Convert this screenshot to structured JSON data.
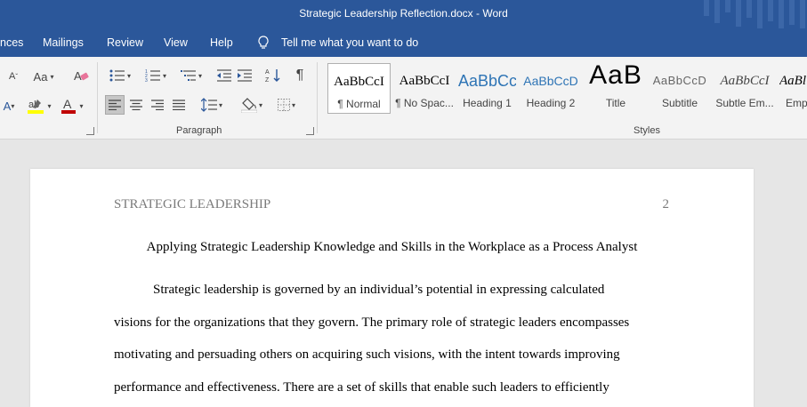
{
  "window": {
    "title": "Strategic Leadership Reflection.docx  -  Word"
  },
  "tabs": [
    "nces",
    "Mailings",
    "Review",
    "View",
    "Help"
  ],
  "tell_me": "Tell me what you want to do",
  "ribbon": {
    "font_size_glyph": "Aa",
    "paragraph_label": "Paragraph",
    "styles_label": "Styles",
    "styles": [
      {
        "preview": "AaBbCcI",
        "name": "¶ Normal"
      },
      {
        "preview": "AaBbCcI",
        "name": "¶ No Spac..."
      },
      {
        "preview": "AaBbCc",
        "name": "Heading 1"
      },
      {
        "preview": "AaBbCcD",
        "name": "Heading 2"
      },
      {
        "preview": "AaB",
        "name": "Title"
      },
      {
        "preview": "AaBbCcD",
        "name": "Subtitle"
      },
      {
        "preview": "AaBbCcI",
        "name": "Subtle Em..."
      },
      {
        "preview": "AaBl",
        "name": "Emp"
      }
    ]
  },
  "document": {
    "running_head": "STRATEGIC LEADERSHIP",
    "page_number": "2",
    "title": "Applying Strategic Leadership Knowledge and Skills in the Workplace as a Process Analyst",
    "lines": [
      "Strategic leadership is governed by an individual’s potential in expressing calculated",
      "visions for the organizations that they govern. The primary role of strategic leaders encompasses",
      "motivating and persuading others on acquiring such visions, with the intent towards improving",
      "performance and effectiveness. There are a set of skills that enable such leaders to efficiently"
    ]
  }
}
